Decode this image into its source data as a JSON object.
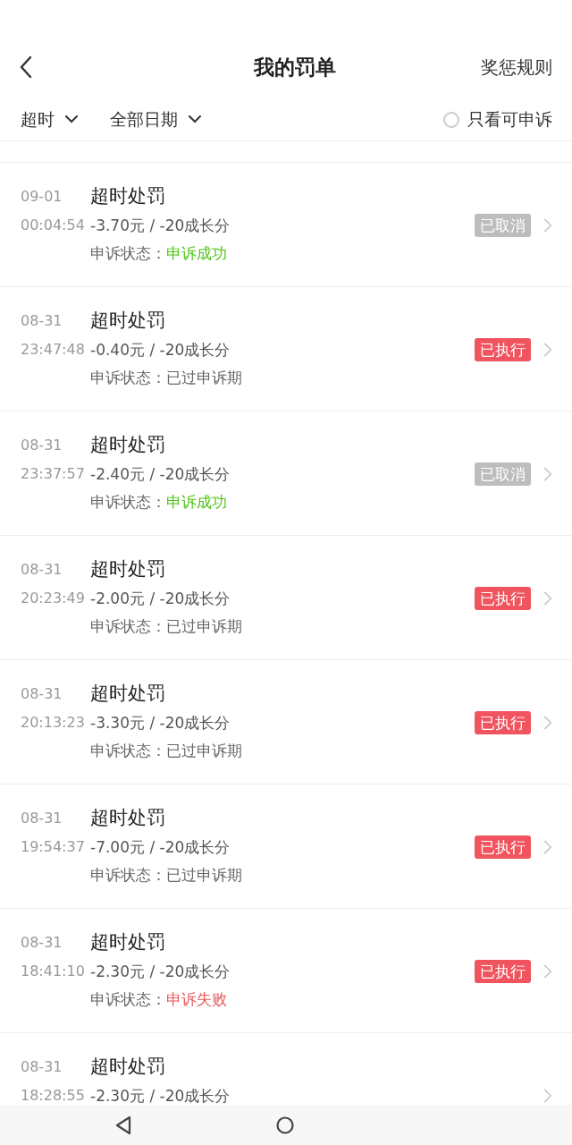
{
  "header": {
    "title": "我的罚单",
    "rules_link": "奖惩规则"
  },
  "filters": [
    {
      "label": "超时"
    },
    {
      "label": "全部日期"
    }
  ],
  "appeal_only": {
    "label": "只看可申诉",
    "checked": false
  },
  "rows": [
    {
      "date": "09-01",
      "time": "00:04:54",
      "title": "超时处罚",
      "amount": "-3.70元 / -20成长分",
      "appeal": {
        "label": "申诉状态：",
        "status": "申诉成功",
        "kind": "success"
      },
      "badge": {
        "text": "已取消",
        "kind": "cancelled"
      }
    },
    {
      "date": "08-31",
      "time": "23:47:48",
      "title": "超时处罚",
      "amount": "-0.40元 / -20成长分",
      "appeal": {
        "label": "申诉状态：",
        "status": "已过申诉期",
        "kind": "expired"
      },
      "badge": {
        "text": "已执行",
        "kind": "executed"
      }
    },
    {
      "date": "08-31",
      "time": "23:37:57",
      "title": "超时处罚",
      "amount": "-2.40元 / -20成长分",
      "appeal": {
        "label": "申诉状态：",
        "status": "申诉成功",
        "kind": "success"
      },
      "badge": {
        "text": "已取消",
        "kind": "cancelled"
      }
    },
    {
      "date": "08-31",
      "time": "20:23:49",
      "title": "超时处罚",
      "amount": "-2.00元 / -20成长分",
      "appeal": {
        "label": "申诉状态：",
        "status": "已过申诉期",
        "kind": "expired"
      },
      "badge": {
        "text": "已执行",
        "kind": "executed"
      }
    },
    {
      "date": "08-31",
      "time": "20:13:23",
      "title": "超时处罚",
      "amount": "-3.30元 / -20成长分",
      "appeal": {
        "label": "申诉状态：",
        "status": "已过申诉期",
        "kind": "expired"
      },
      "badge": {
        "text": "已执行",
        "kind": "executed"
      }
    },
    {
      "date": "08-31",
      "time": "19:54:37",
      "title": "超时处罚",
      "amount": "-7.00元 / -20成长分",
      "appeal": {
        "label": "申诉状态：",
        "status": "已过申诉期",
        "kind": "expired"
      },
      "badge": {
        "text": "已执行",
        "kind": "executed"
      }
    },
    {
      "date": "08-31",
      "time": "18:41:10",
      "title": "超时处罚",
      "amount": "-2.30元 / -20成长分",
      "appeal": {
        "label": "申诉状态：",
        "status": "申诉失败",
        "kind": "failed"
      },
      "badge": {
        "text": "已执行",
        "kind": "executed"
      }
    },
    {
      "date": "08-31",
      "time": "18:28:55",
      "title": "超时处罚",
      "amount": "-2.30元 / -20成长分"
    }
  ]
}
